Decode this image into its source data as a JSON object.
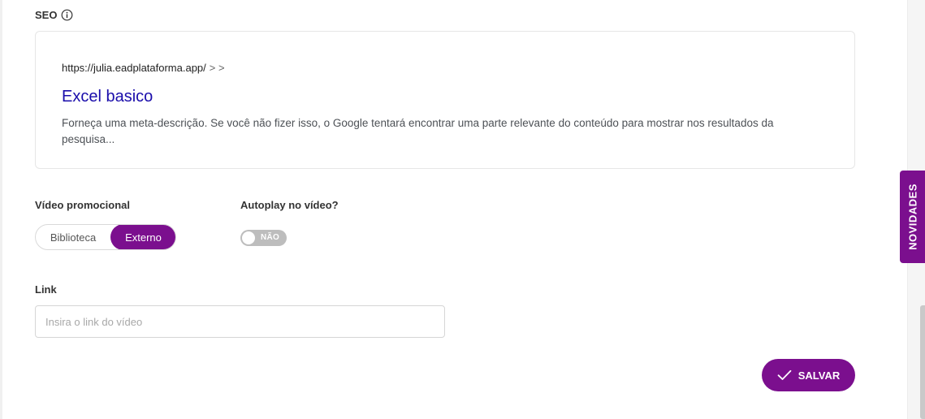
{
  "seo": {
    "label": "SEO",
    "preview": {
      "url": "https://julia.eadplataforma.app/",
      "url_separators": "> >",
      "title": "Excel basico",
      "description": "Forneça uma meta-descrição. Se você não fizer isso, o Google tentará encontrar uma parte relevante do conteúdo para mostrar nos resultados da pesquisa..."
    }
  },
  "promo_video": {
    "label": "Vídeo promocional",
    "options": [
      "Biblioteca",
      "Externo"
    ],
    "selected": "Externo"
  },
  "autoplay": {
    "label": "Autoplay no vídeo?",
    "state_text": "NÃO",
    "enabled": false
  },
  "link": {
    "label": "Link",
    "placeholder": "Insira o link do vídeo",
    "value": ""
  },
  "save_button": {
    "label": "SALVAR",
    "icon": "check-icon"
  },
  "news_tab": {
    "label": "NOVIDADES"
  },
  "colors": {
    "accent": "#7b0f8e",
    "seo_title": "#1a0dab",
    "toggle_off": "#bdbdbd"
  }
}
